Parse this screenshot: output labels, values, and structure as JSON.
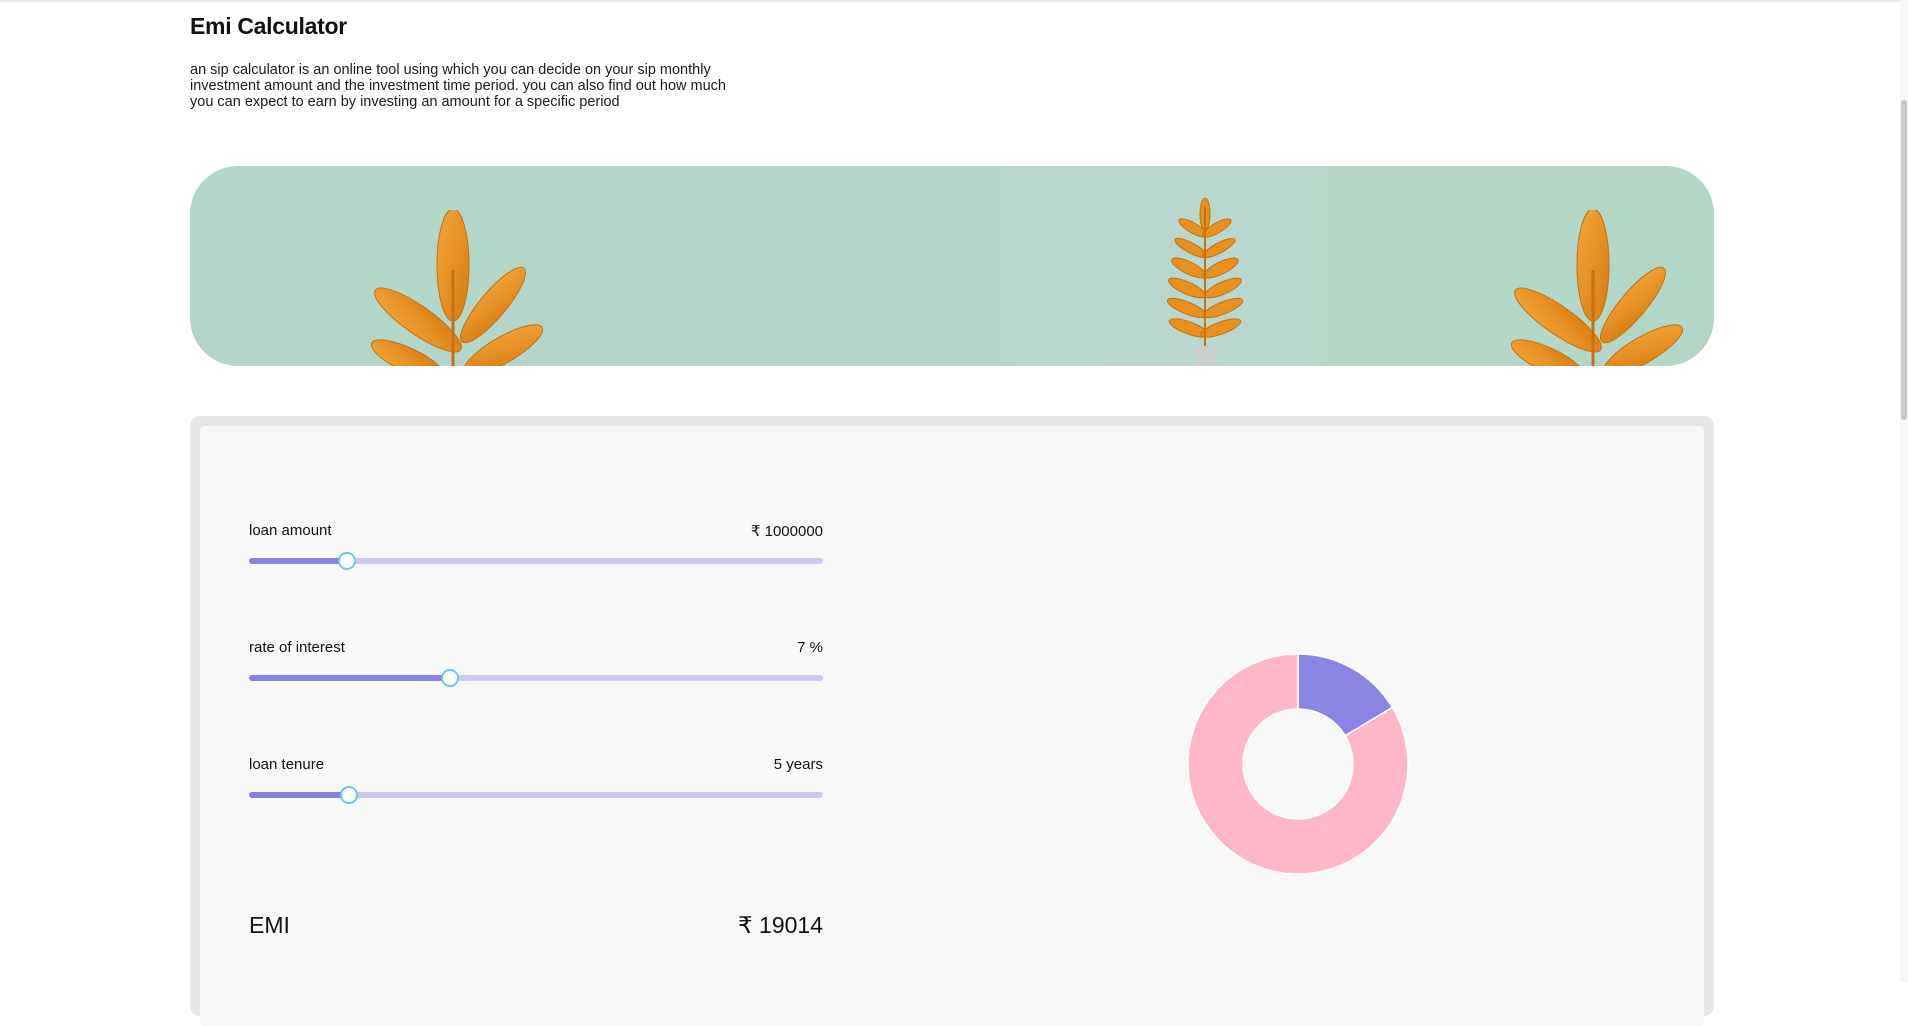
{
  "page": {
    "title": "Emi Calculator",
    "description": "an sip calculator is an online tool using which you can decide on your sip monthly investment amount and the investment time period. you can also find out how much you can expect to earn by investing an amount for a specific period"
  },
  "calculator": {
    "fields": [
      {
        "label": "loan amount",
        "value": "₹ 1000000",
        "fill": 0.17
      },
      {
        "label": "rate of interest",
        "value": "7 %",
        "fill": 0.35
      },
      {
        "label": "loan tenure",
        "value": "5 years",
        "fill": 0.175
      }
    ],
    "emi": {
      "label": "EMI",
      "value": "₹ 19014"
    }
  },
  "chart_data": {
    "type": "pie",
    "donut": true,
    "slices": [
      {
        "name": "",
        "value": 0.164,
        "color": "#8a84e3"
      },
      {
        "name": "",
        "value": 0.836,
        "color": "#ffb6c8"
      }
    ]
  },
  "colors": {
    "slider_track": "#cac9f0",
    "slider_fill": "#8583e2",
    "slider_thumb_border": "#6ec6e8",
    "banner_bg": "#b2d6c7",
    "leaf": "#e8901e"
  }
}
